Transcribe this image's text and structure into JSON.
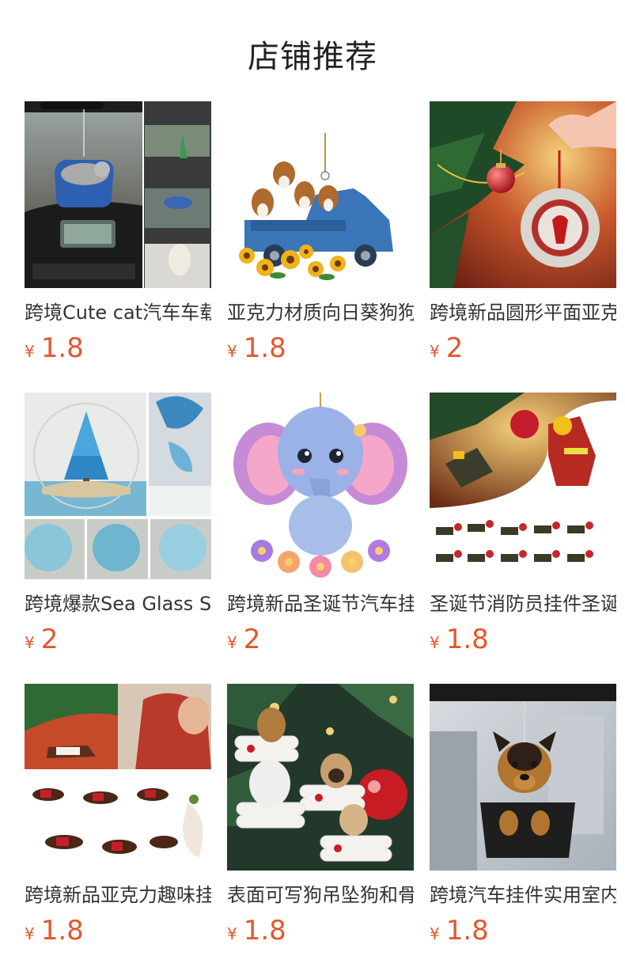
{
  "header": {
    "title": "店铺推荐"
  },
  "currency_symbol": "¥",
  "products": [
    {
      "title": "跨境Cute cat汽车车载挂件",
      "price": "1.8",
      "image_icon": "cat-car-ornament-image"
    },
    {
      "title": "亚克力材质向日葵狗狗挂件",
      "price": "1.8",
      "image_icon": "dog-truck-sunflower-image"
    },
    {
      "title": "跨境新品圆形平面亚克力挂件",
      "price": "2",
      "image_icon": "cardinal-bauble-image"
    },
    {
      "title": "跨境爆款Sea Glass Sun",
      "price": "2",
      "image_icon": "sea-glass-tree-image"
    },
    {
      "title": "跨境新品圣诞节汽车挂件",
      "price": "2",
      "image_icon": "elephant-ornament-image"
    },
    {
      "title": "圣诞节消防员挂件圣诞树",
      "price": "1.8",
      "image_icon": "firefighter-ornament-image"
    },
    {
      "title": "跨境新品亚克力趣味挂件",
      "price": "1.8",
      "image_icon": "dachshund-ornament-image"
    },
    {
      "title": "表面可写狗吊坠狗和骨头",
      "price": "1.8",
      "image_icon": "dog-bone-ornament-image"
    },
    {
      "title": "跨境汽车挂件实用室内挂件",
      "price": "1.8",
      "image_icon": "shepherd-dog-car-image"
    }
  ]
}
